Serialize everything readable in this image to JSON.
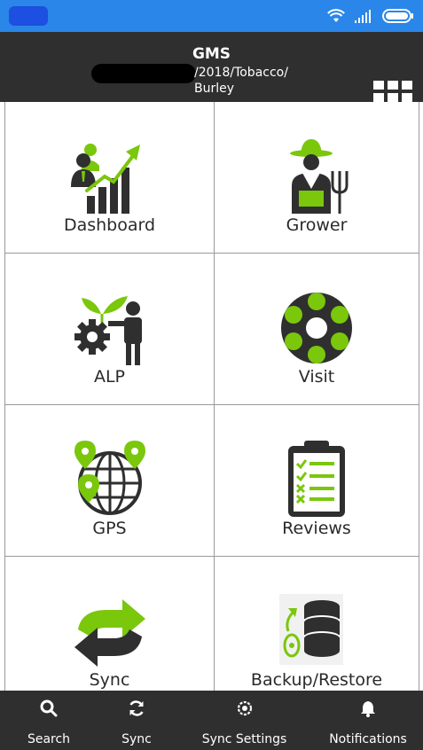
{
  "colors": {
    "status_bar": "#2a86e8",
    "header": "#2f2f2f",
    "accent_green": "#7ac70c",
    "icon_dark": "#2f2f2f",
    "bottom_nav": "#2f2f2f"
  },
  "status_bar": {
    "icons": [
      "wifi-icon",
      "signal-icon",
      "battery-icon"
    ]
  },
  "header": {
    "title": "GMS",
    "path_line1": "/2018/Tobacco/",
    "path_line2": "Burley",
    "apps_icon": "grid-icon"
  },
  "tiles": [
    {
      "label": "Dashboard",
      "icon": "dashboard-icon"
    },
    {
      "label": "Grower",
      "icon": "grower-icon"
    },
    {
      "label": "ALP",
      "icon": "alp-icon"
    },
    {
      "label": "Visit",
      "icon": "visit-icon"
    },
    {
      "label": "GPS",
      "icon": "gps-icon"
    },
    {
      "label": "Reviews",
      "icon": "reviews-icon"
    },
    {
      "label": "Sync",
      "icon": "sync-icon"
    },
    {
      "label": "Backup/Restore",
      "icon": "backup-restore-icon"
    }
  ],
  "bottom_nav": [
    {
      "label": "Search",
      "icon": "search-icon"
    },
    {
      "label": "Sync",
      "icon": "sync-icon"
    },
    {
      "label": "Sync Settings",
      "icon": "sync-settings-icon"
    },
    {
      "label": "Notifications",
      "icon": "bell-icon"
    }
  ]
}
